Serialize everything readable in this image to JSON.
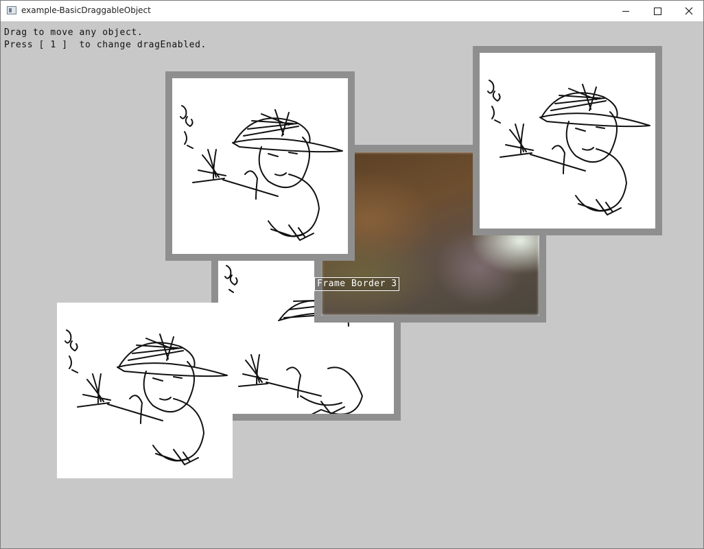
{
  "window": {
    "title": "example-BasicDraggableObject",
    "icon": "app-window-icon",
    "controls": {
      "minimize": "minimize-icon",
      "maximize": "maximize-icon",
      "close": "close-icon"
    }
  },
  "canvas": {
    "background": "#c8c8c8",
    "instructions": {
      "line1": "Drag to move any object.",
      "line2": "Press [ 1 ]  to change dragEnabled."
    }
  },
  "frames": [
    {
      "name": "frame-photo-bordered",
      "content": "blurred photo",
      "label": "Frame Border 3",
      "border_color": "#8f8f8f"
    },
    {
      "name": "frame-sketch-bordered-back",
      "content": "sketch",
      "border_color": "#8f8f8f"
    },
    {
      "name": "frame-sketch-bordered-top",
      "content": "sketch",
      "border_color": "#8f8f8f"
    },
    {
      "name": "frame-sketch-bordered-right",
      "content": "sketch",
      "border_color": "#8f8f8f"
    },
    {
      "name": "frame-sketch-plain",
      "content": "sketch"
    }
  ],
  "colors": {
    "border": "#8f8f8f",
    "image_bg": "#ffffff",
    "label_text": "#ffffff"
  }
}
